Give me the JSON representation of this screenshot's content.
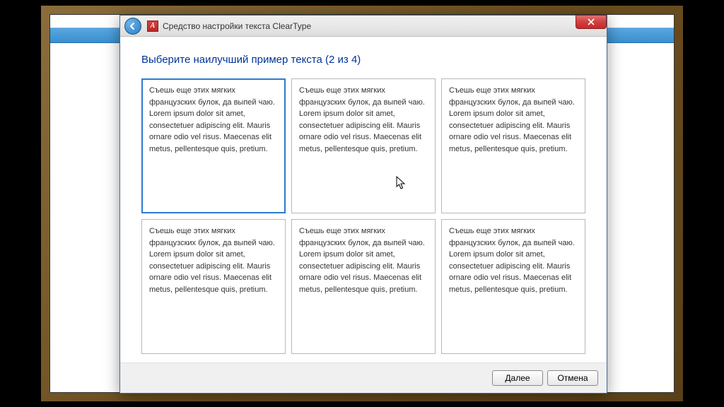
{
  "window": {
    "title": "Средство настройки текста ClearType",
    "close_label": "Close"
  },
  "wizard": {
    "heading": "Выберите наилучший пример текста (2 из 4)",
    "sample_text": "Съешь еще этих мягких французских булок, да выпей чаю. Lorem ipsum dolor sit amet, consectetuer adipiscing elit. Mauris ornare odio vel risus. Maecenas elit metus, pellentesque quis, pretium.",
    "selected_index": 0,
    "samples": [
      0,
      1,
      2,
      3,
      4,
      5
    ]
  },
  "buttons": {
    "next": "Далее",
    "cancel": "Отмена"
  }
}
